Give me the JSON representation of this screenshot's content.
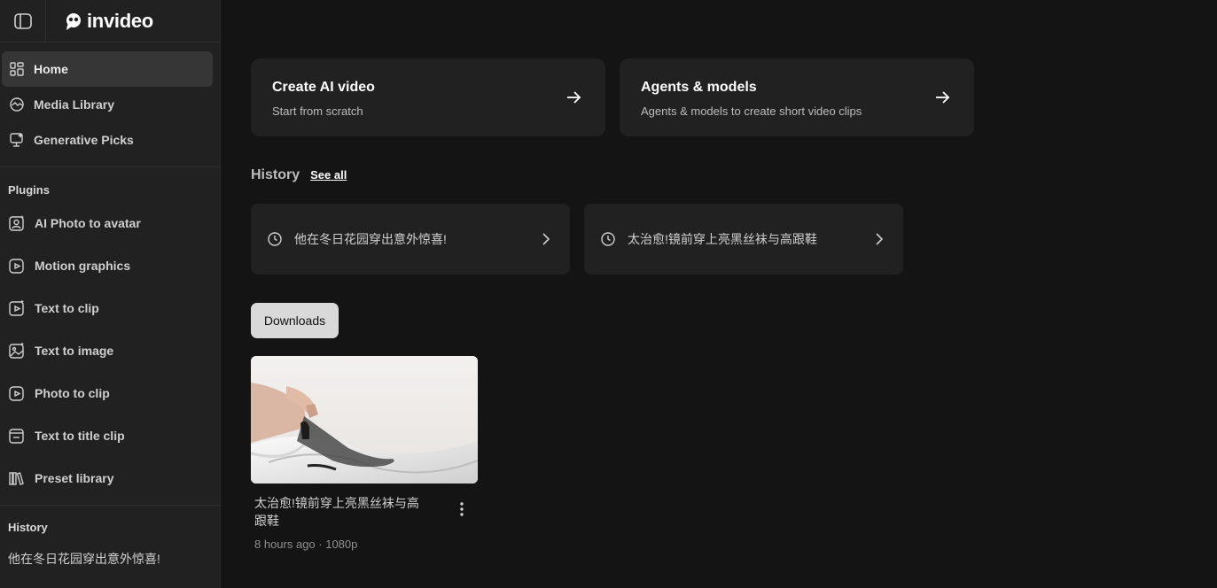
{
  "app": {
    "brand": "invideo"
  },
  "sidebar": {
    "nav": [
      {
        "label": "Home",
        "icon": "grid-icon"
      },
      {
        "label": "Media Library",
        "icon": "media-library-icon"
      },
      {
        "label": "Generative Picks",
        "icon": "generative-picks-icon"
      }
    ],
    "plugins_title": "Plugins",
    "plugins": [
      {
        "label": "AI Photo to avatar",
        "icon": "avatar-icon"
      },
      {
        "label": "Motion graphics",
        "icon": "play-circle-icon"
      },
      {
        "label": "Text to clip",
        "icon": "clip-icon"
      },
      {
        "label": "Text to image",
        "icon": "image-icon"
      },
      {
        "label": "Photo to clip",
        "icon": "play-square-icon"
      },
      {
        "label": "Text to title clip",
        "icon": "title-clip-icon"
      },
      {
        "label": "Preset library",
        "icon": "books-icon"
      }
    ],
    "history_title": "History",
    "history": [
      "他在冬日花园穿出意外惊喜!"
    ]
  },
  "main": {
    "cards": [
      {
        "title": "Create AI video",
        "subtitle": "Start from scratch"
      },
      {
        "title": "Agents & models",
        "subtitle": "Agents & models to create short video clips"
      }
    ],
    "history": {
      "title": "History",
      "see_all": "See all",
      "items": [
        "他在冬日花园穿出意外惊喜!",
        "太治愈!镜前穿上亮黑丝袜与高跟鞋"
      ]
    },
    "downloads_label": "Downloads",
    "video": {
      "title_line1": "太治愈!镜前穿上亮黑丝袜与高",
      "title_line2": "跟鞋",
      "meta": "8 hours ago · 1080p"
    }
  },
  "colors": {
    "background": "#141414",
    "sidebar": "#212121",
    "card": "#212121",
    "active": "#363636",
    "pill": "#d9d9d9"
  }
}
